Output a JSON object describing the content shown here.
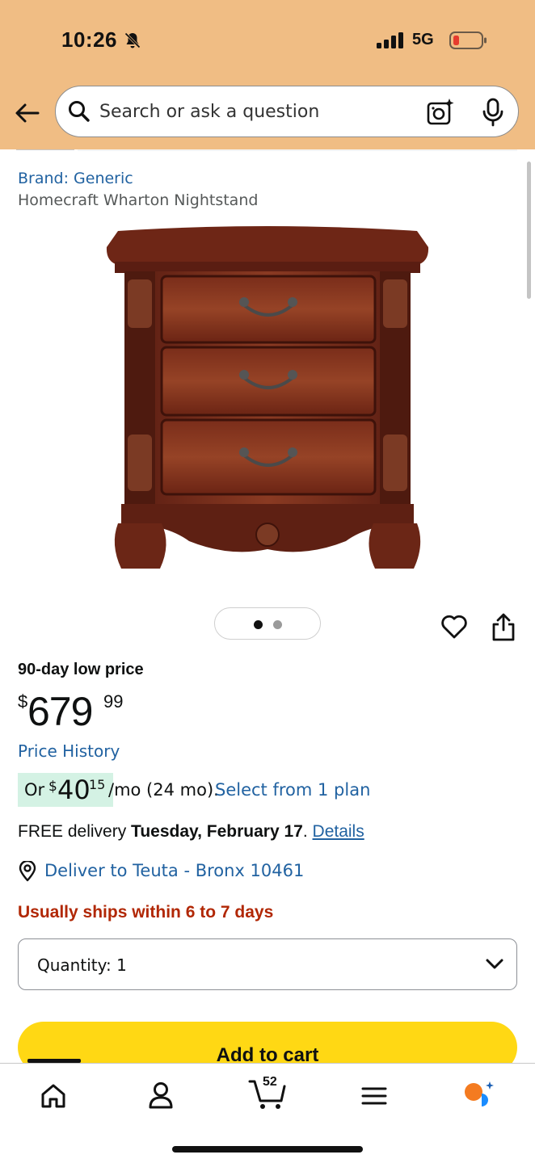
{
  "status_bar": {
    "time": "10:26",
    "network": "5G"
  },
  "search": {
    "placeholder": "Search or ask a question"
  },
  "product": {
    "brand": "Brand: Generic",
    "title": "Homecraft Wharton Nightstand",
    "image_icon": "nightstand-image",
    "carousel": {
      "total": 2,
      "active": 1
    }
  },
  "pricing": {
    "deal_label": "90-day low price",
    "currency": "$",
    "price_whole": "679",
    "price_fraction": "99",
    "price_history_link": "Price History",
    "installment": {
      "prefix": "Or",
      "currency": "$",
      "whole": "40",
      "fraction": "15",
      "term": "/mo (24 mo).",
      "link": "Select from 1 plan"
    }
  },
  "delivery": {
    "prefix": "FREE delivery",
    "date": "Tuesday, February 17",
    "details_link": "Details",
    "deliver_to": "Deliver to Teuta - Bronx 10461",
    "ships_note": "Usually ships within 6 to 7 days"
  },
  "quantity": {
    "label": "Quantity: 1"
  },
  "cart_button": {
    "label": "Add to cart"
  },
  "bottom_nav": {
    "cart_count": "52",
    "items": [
      "home-icon",
      "account-icon",
      "cart-icon",
      "menu-icon",
      "rufus-icon"
    ]
  },
  "colors": {
    "header_bg": "#f0bd84",
    "link": "#2162a1",
    "ships_red": "#b12704",
    "add_to_cart": "#ffd814",
    "installment_highlight": "#d4f2e4"
  }
}
